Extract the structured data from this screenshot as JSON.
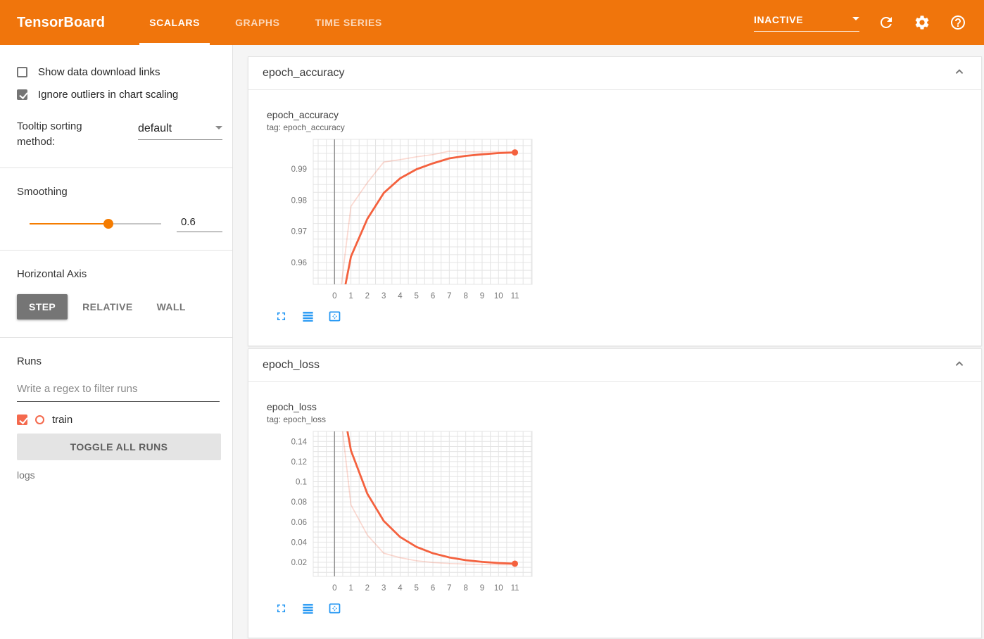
{
  "header": {
    "brand": "TensorBoard",
    "tabs": [
      {
        "label": "SCALARS",
        "active": true
      },
      {
        "label": "GRAPHS",
        "active": false
      },
      {
        "label": "TIME SERIES",
        "active": false
      }
    ],
    "status": "INACTIVE",
    "icons": [
      "refresh-icon",
      "settings-icon",
      "help-icon"
    ]
  },
  "sidebar": {
    "checkboxes": [
      {
        "label": "Show data download links",
        "checked": false
      },
      {
        "label": "Ignore outliers in chart scaling",
        "checked": true
      }
    ],
    "tooltip_sorting": {
      "label": "Tooltip sorting method:",
      "value": "default"
    },
    "smoothing": {
      "label": "Smoothing",
      "value": "0.6",
      "percent": 60
    },
    "horizontal_axis": {
      "label": "Horizontal Axis",
      "options": [
        {
          "label": "STEP",
          "active": true
        },
        {
          "label": "RELATIVE",
          "active": false
        },
        {
          "label": "WALL",
          "active": false
        }
      ]
    },
    "runs": {
      "label": "Runs",
      "filter_placeholder": "Write a regex to filter runs",
      "items": [
        {
          "label": "train",
          "checked": true,
          "color": "#f4694d"
        }
      ],
      "toggle_button": "TOGGLE ALL RUNS",
      "footer": "logs"
    }
  },
  "cards": [
    {
      "title": "epoch_accuracy",
      "tag_line": "tag: epoch_accuracy"
    },
    {
      "title": "epoch_loss",
      "tag_line": "tag: epoch_loss"
    }
  ],
  "colors": {
    "appbar": "#f0750c",
    "accent_orange": "#f57c00",
    "run_color": "#f4613e",
    "toolbar_blue": "#2196f3",
    "grid": "#e4e4e4",
    "zero_line": "#8f8f8f",
    "tick_text": "#757575"
  },
  "chart_data": [
    {
      "type": "line",
      "title": "epoch_accuracy",
      "tag": "epoch_accuracy",
      "xlabel": "",
      "ylabel": "",
      "x": [
        0,
        1,
        2,
        3,
        4,
        5,
        6,
        7,
        8,
        9,
        10,
        11
      ],
      "series": [
        {
          "name": "train (smoothed 0.6)",
          "values": [
            0.935,
            0.9619,
            0.974,
            0.9823,
            0.987,
            0.9899,
            0.9918,
            0.9934,
            0.9942,
            0.9947,
            0.9951,
            0.9953
          ]
        },
        {
          "name": "train",
          "values": [
            0.935,
            0.978,
            0.9856,
            0.9922,
            0.993,
            0.9939,
            0.9946,
            0.9957,
            0.9955,
            0.9955,
            0.9956,
            0.9955
          ]
        }
      ],
      "xlim": [
        -1.3,
        12.05
      ],
      "ylim": [
        0.953,
        0.9995
      ],
      "xticks": [
        0,
        1,
        2,
        3,
        4,
        5,
        6,
        7,
        8,
        9,
        10,
        11
      ],
      "yticks": [
        0.96,
        0.97,
        0.98,
        0.99
      ],
      "x_minor_step": 0.5,
      "y_minor_step": 0.0025,
      "grid": true,
      "legend": "none",
      "endpoint_marker": true
    },
    {
      "type": "line",
      "title": "epoch_loss",
      "tag": "epoch_loss",
      "xlabel": "",
      "ylabel": "",
      "x": [
        0,
        1,
        2,
        3,
        4,
        5,
        6,
        7,
        8,
        9,
        10,
        11
      ],
      "series": [
        {
          "name": "train (smoothed 0.6)",
          "values": [
            0.221,
            0.131,
            0.0881,
            0.061,
            0.0451,
            0.0352,
            0.0289,
            0.0248,
            0.0221,
            0.0204,
            0.0193,
            0.0186
          ]
        },
        {
          "name": "train",
          "values": [
            0.221,
            0.077,
            0.047,
            0.029,
            0.0245,
            0.0215,
            0.0198,
            0.0188,
            0.0182,
            0.0178,
            0.0176,
            0.0175
          ]
        }
      ],
      "xlim": [
        -1.3,
        12.05
      ],
      "ylim": [
        0.006,
        0.15
      ],
      "xticks": [
        0,
        1,
        2,
        3,
        4,
        5,
        6,
        7,
        8,
        9,
        10,
        11
      ],
      "yticks": [
        0.02,
        0.04,
        0.06,
        0.08,
        0.1,
        0.12,
        0.14
      ],
      "x_minor_step": 0.5,
      "y_minor_step": 0.005,
      "grid": true,
      "legend": "none",
      "endpoint_marker": true
    }
  ]
}
